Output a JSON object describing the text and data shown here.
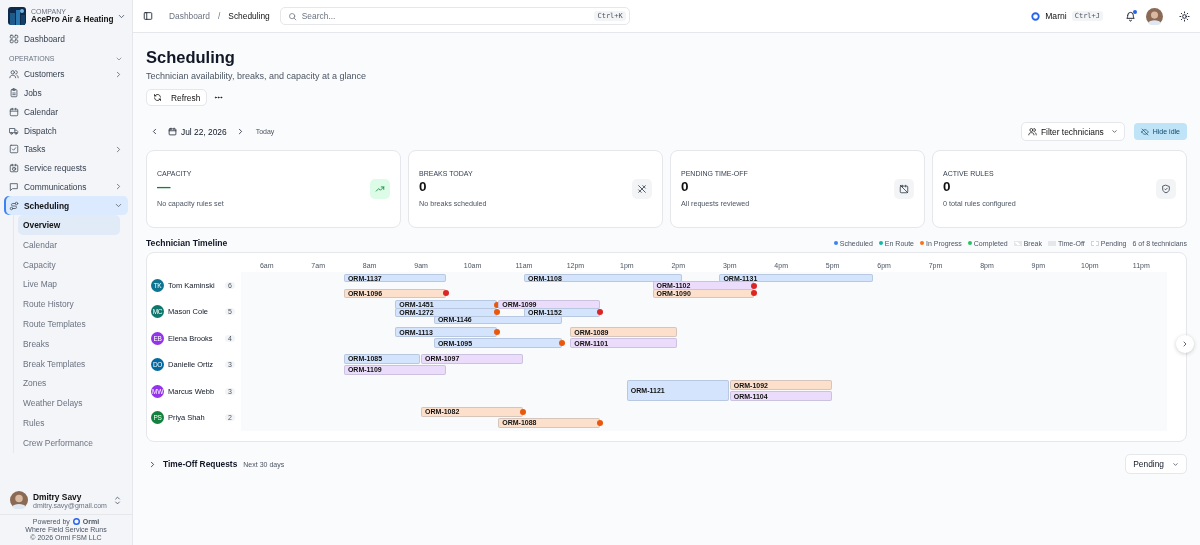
{
  "company": {
    "label": "COMPANY",
    "name": "AcePro Air & Heating"
  },
  "sidebar": {
    "top_items": [
      {
        "label": "Dashboard",
        "selected": false
      }
    ],
    "section": {
      "title": "OPERATIONS",
      "expanded": true
    },
    "items": [
      {
        "label": "Customers",
        "expanded": false,
        "selected": false
      },
      {
        "label": "Jobs",
        "selected": false
      },
      {
        "label": "Calendar",
        "selected": false
      },
      {
        "label": "Dispatch",
        "selected": false
      },
      {
        "label": "Tasks",
        "expanded": false,
        "selected": false
      },
      {
        "label": "Service requests",
        "selected": false
      },
      {
        "label": "Communications",
        "expanded": false,
        "selected": false
      },
      {
        "label": "Scheduling",
        "expanded": true,
        "selected": true,
        "children": [
          {
            "label": "Overview",
            "selected": true
          },
          {
            "label": "Calendar",
            "selected": false
          },
          {
            "label": "Capacity",
            "selected": false
          },
          {
            "label": "Live Map",
            "selected": false
          },
          {
            "label": "Route History",
            "selected": false
          },
          {
            "label": "Route Templates",
            "selected": false
          },
          {
            "label": "Breaks",
            "selected": false
          },
          {
            "label": "Break Templates",
            "selected": false
          },
          {
            "label": "Zones",
            "selected": false
          },
          {
            "label": "Weather Delays",
            "selected": false
          },
          {
            "label": "Rules",
            "selected": false
          },
          {
            "label": "Crew Performance",
            "selected": false
          }
        ]
      }
    ],
    "user": {
      "name": "Dmitry Savy",
      "email": "dmitry.savy@gmail.com"
    },
    "footer": {
      "powered_by": "Powered by",
      "brand": "Ormi",
      "tagline": "Where Field Service Runs",
      "copyright": "© 2026 Ormi FSM LLC"
    }
  },
  "header": {
    "breadcrumb": [
      "Dashboard",
      "Scheduling"
    ],
    "separator": "/",
    "search": {
      "placeholder": "Search...",
      "shortcut": "Ctrl+K"
    },
    "assistant": {
      "name": "Marni",
      "shortcut": "Ctrl+J"
    }
  },
  "page": {
    "title": "Scheduling",
    "subtitle": "Technician availability, breaks, and capacity at a glance",
    "refresh": "Refresh"
  },
  "date_nav": {
    "date": "Jul 22, 2026",
    "today": "Today",
    "filter": "Filter technicians",
    "hide_idle": {
      "label": "Hide idle",
      "on": true
    }
  },
  "stats": [
    {
      "label": "CAPACITY",
      "value": "—",
      "note": "No capacity rules set",
      "kind": "success"
    },
    {
      "label": "BREAKS TODAY",
      "value": "0",
      "note": "No breaks scheduled",
      "kind": "neutral"
    },
    {
      "label": "PENDING TIME-OFF",
      "value": "0",
      "note": "All requests reviewed",
      "kind": "neutral"
    },
    {
      "label": "ACTIVE RULES",
      "value": "0",
      "note": "0 total rules configured",
      "kind": "neutral"
    }
  ],
  "timeline": {
    "title": "Technician Timeline",
    "legend": [
      {
        "label": "Scheduled",
        "kind": "dot",
        "color": "#3b82f6"
      },
      {
        "label": "En Route",
        "kind": "dot",
        "color": "#14b8a6"
      },
      {
        "label": "In Progress",
        "kind": "dot",
        "color": "#f97316"
      },
      {
        "label": "Completed",
        "kind": "dot",
        "color": "#22c55e"
      },
      {
        "label": "Break",
        "kind": "striped"
      },
      {
        "label": "Time-Off",
        "kind": "shaded"
      },
      {
        "label": "Pending",
        "kind": "outline"
      }
    ],
    "count": "6 of 8 technicians",
    "hours": [
      "6am",
      "7am",
      "8am",
      "9am",
      "10am",
      "11am",
      "12pm",
      "1pm",
      "2pm",
      "3pm",
      "4pm",
      "5pm",
      "6pm",
      "7pm",
      "8pm",
      "9pm",
      "10pm",
      "11pm"
    ],
    "technicians": [
      {
        "initials": "TK",
        "name": "Tom Kaminski",
        "count": "6",
        "color": "#0e7490",
        "bars": [
          {
            "id": "ORM-1137",
            "color": "#d4e4fc"
          },
          {
            "id": "ORM-1108",
            "color": "#d4e4fc"
          },
          {
            "id": "ORM-1131",
            "color": "#d4e4fc"
          },
          {
            "id": "ORM-1102",
            "color": "#ecdcfb",
            "alert": {
              "color": "#dc2626"
            }
          },
          {
            "id": "ORM-1096",
            "color": "#fde0cc",
            "alert": {
              "color": "#dc2626"
            }
          },
          {
            "id": "ORM-1090",
            "color": "#fde0cc",
            "alert": {
              "color": "#dc2626"
            }
          }
        ]
      },
      {
        "initials": "MC",
        "name": "Mason Cole",
        "count": "5",
        "color": "#0f766e",
        "bars": [
          {
            "id": "ORM-1451",
            "color": "#d4e4fc",
            "alert": {
              "color": "#ea580c"
            }
          },
          {
            "id": "ORM-1099",
            "color": "#ecdcfb"
          },
          {
            "id": "ORM-1272",
            "color": "#d4e4fc",
            "alert": {
              "color": "#ea580c"
            }
          },
          {
            "id": "ORM-1152",
            "color": "#d4e4fc",
            "alert": {
              "color": "#dc2626"
            }
          },
          {
            "id": "ORM-1146",
            "color": "#d4e4fc"
          }
        ]
      },
      {
        "initials": "EB",
        "name": "Elena Brooks",
        "count": "4",
        "color": "#9333ea",
        "bars": [
          {
            "id": "ORM-1113",
            "color": "#d4e4fc",
            "alert": {
              "color": "#ea580c"
            }
          },
          {
            "id": "ORM-1089",
            "color": "#fde0cc"
          },
          {
            "id": "ORM-1095",
            "color": "#d4e4fc",
            "alert": {
              "color": "#ea580c"
            }
          },
          {
            "id": "ORM-1101",
            "color": "#ecdcfb"
          }
        ]
      },
      {
        "initials": "DO",
        "name": "Danielle Ortiz",
        "count": "3",
        "color": "#0369a1",
        "bars": [
          {
            "id": "ORM-1085",
            "color": "#d4e4fc"
          },
          {
            "id": "ORM-1097",
            "color": "#ecdcfb"
          },
          {
            "id": "ORM-1109",
            "color": "#ecdcfb"
          }
        ]
      },
      {
        "initials": "MW",
        "name": "Marcus Webb",
        "count": "3",
        "color": "#9333ea",
        "bars": [
          {
            "id": "ORM-1121",
            "color": "#d4e4fc"
          },
          {
            "id": "ORM-1092",
            "color": "#fde0cc"
          },
          {
            "id": "ORM-1104",
            "color": "#ecdcfb"
          }
        ]
      },
      {
        "initials": "PS",
        "name": "Priya Shah",
        "count": "2",
        "color": "#15803d",
        "bars": [
          {
            "id": "ORM-1082",
            "color": "#fde0cc",
            "alert": {
              "color": "#ea580c"
            }
          },
          {
            "id": "ORM-1088",
            "color": "#fde0cc",
            "alert": {
              "color": "#ea580c"
            }
          }
        ]
      }
    ]
  },
  "time_off": {
    "title": "Time-Off Requests",
    "note": "Next 30 days",
    "expanded": false,
    "filter": "Pending"
  }
}
